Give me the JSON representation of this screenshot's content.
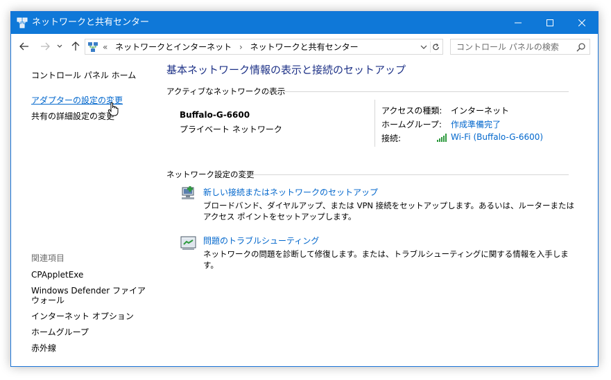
{
  "window": {
    "title": "ネットワークと共有センター",
    "accent": "#0f78d8",
    "link_color": "#0066cc",
    "heading_color": "#1e3287"
  },
  "address": {
    "overflow": "«",
    "crumbs": [
      "ネットワークとインターネット",
      "ネットワークと共有センター"
    ],
    "separator": "›"
  },
  "search": {
    "placeholder": "コントロール パネルの検索"
  },
  "sidebar": {
    "home": "コントロール パネル ホーム",
    "adapter": "アダプターの設定の変更",
    "sharing": "共有の詳細設定の変更",
    "related_head": "関連項目",
    "related": [
      "CPAppletExe",
      "Windows Defender ファイアウォール",
      "インターネット オプション",
      "ホームグループ",
      "赤外線"
    ]
  },
  "main": {
    "title": "基本ネットワーク情報の表示と接続のセットアップ",
    "active_head": "アクティブなネットワークの表示",
    "network": {
      "name": "Buffalo-G-6600",
      "type": "プライベート ネットワーク",
      "access_label": "アクセスの種類:",
      "access_value": "インターネット",
      "homegroup_label": "ホームグループ:",
      "homegroup_value": "作成準備完了",
      "conn_label": "接続:",
      "conn_value": "Wi-Fi (Buffalo-G-6600)"
    },
    "change_head": "ネットワーク設定の変更",
    "tasks": [
      {
        "link": "新しい接続またはネットワークのセットアップ",
        "desc": "ブロードバンド、ダイヤルアップ、または VPN 接続をセットアップします。あるいは、ルーターまたはアクセス ポイントをセットアップします。"
      },
      {
        "link": "問題のトラブルシューティング",
        "desc": "ネットワークの問題を診断して修復します。または、トラブルシューティングに関する情報を入手します。"
      }
    ]
  }
}
